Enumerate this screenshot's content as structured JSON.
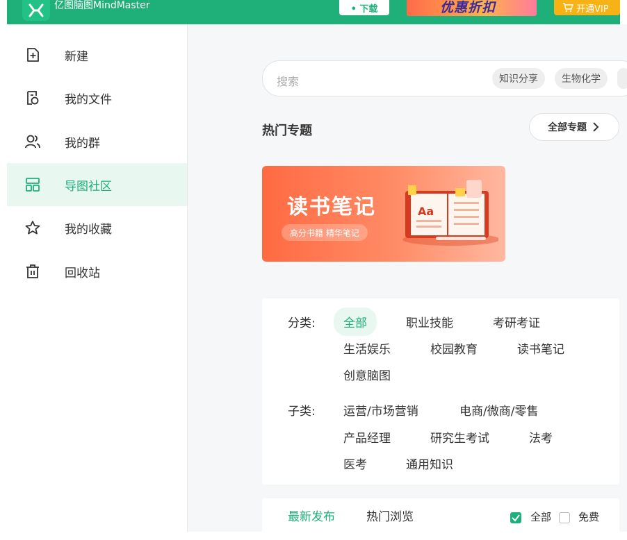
{
  "app": {
    "title": "亿图脑图MindMaster"
  },
  "header": {
    "download_label": "• 下载",
    "promo_text": "优惠折扣",
    "vip_label": "开通VIP"
  },
  "sidebar": {
    "items": [
      {
        "label": "新建",
        "icon": "new-file-icon"
      },
      {
        "label": "我的文件",
        "icon": "my-files-icon"
      },
      {
        "label": "我的群",
        "icon": "group-icon"
      },
      {
        "label": "导图社区",
        "icon": "community-icon",
        "active": true
      },
      {
        "label": "我的收藏",
        "icon": "star-icon"
      },
      {
        "label": "回收站",
        "icon": "trash-icon"
      }
    ]
  },
  "search": {
    "placeholder": "搜索",
    "tags": [
      "知识分享",
      "生物化学"
    ]
  },
  "hot_topics": {
    "title": "热门专题",
    "all_label": "全部专题"
  },
  "banner": {
    "title": "读书笔记",
    "subtitle": "高分书籍 精华笔记",
    "book_text": "Aa"
  },
  "filters": {
    "category_label": "分类:",
    "categories": [
      "全部",
      "职业技能",
      "考研考证",
      "生活娱乐",
      "校园教育",
      "读书笔记",
      "创意脑图"
    ],
    "subcategory_label": "子类:",
    "subcategories": [
      "运营/市场营销",
      "电商/微商/零售",
      "产品经理",
      "研究生考试",
      "法考",
      "医考",
      "通用知识"
    ]
  },
  "list": {
    "tabs": [
      "最新发布",
      "热门浏览"
    ],
    "filters": [
      {
        "label": "全部",
        "checked": true
      },
      {
        "label": "免费",
        "checked": false
      }
    ]
  },
  "colors": {
    "brand": "#1fb07a",
    "vip": "#f7b316",
    "banner": "#ff6a42"
  }
}
